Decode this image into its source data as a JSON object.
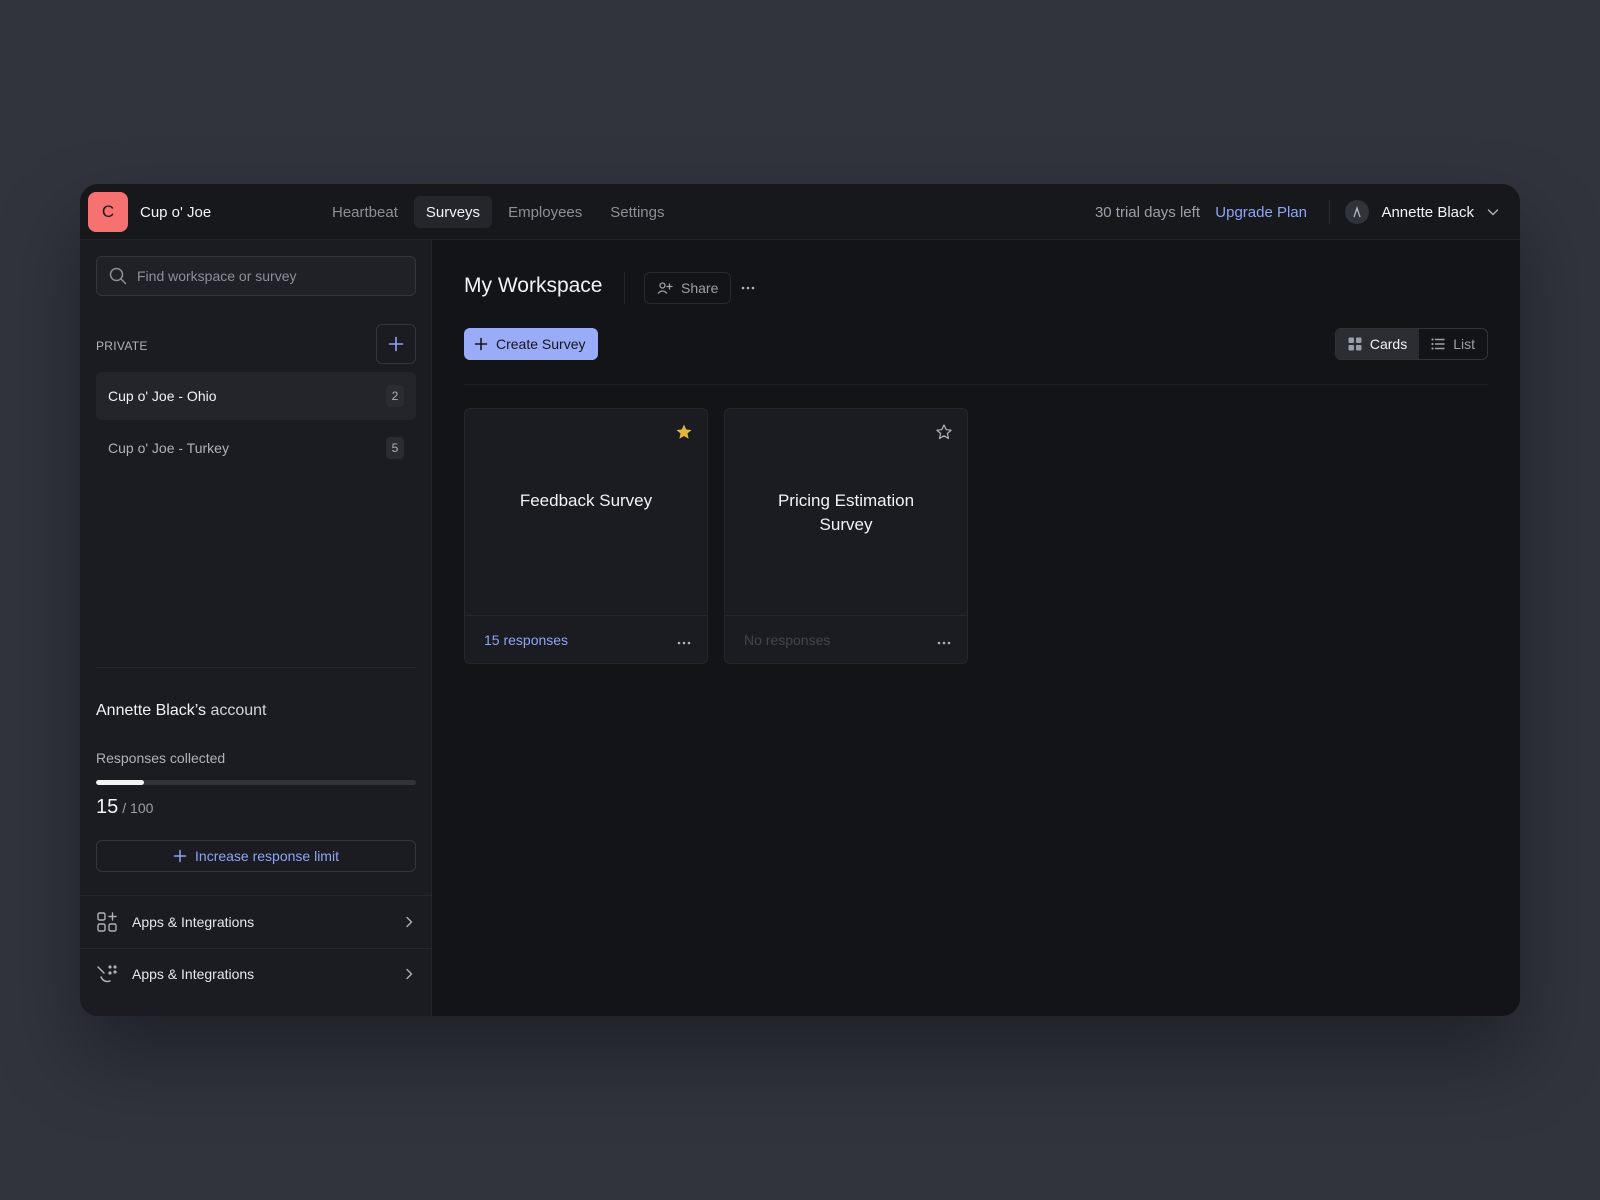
{
  "app": {
    "logo_letter": "C",
    "brand": "Cup o' Joe"
  },
  "nav": {
    "items": [
      {
        "label": "Heartbeat",
        "active": false
      },
      {
        "label": "Surveys",
        "active": true
      },
      {
        "label": "Employees",
        "active": false
      },
      {
        "label": "Settings",
        "active": false
      }
    ]
  },
  "header": {
    "trial_text": "30 trial days left",
    "upgrade_label": "Upgrade Plan",
    "user_name": "Annette Black"
  },
  "sidebar": {
    "search_placeholder": "Find workspace or survey",
    "section_label": "PRIVATE",
    "workspaces": [
      {
        "name": "Cup o' Joe - Ohio",
        "count": "2",
        "active": true
      },
      {
        "name": "Cup o' Joe - Turkey",
        "count": "5",
        "active": false
      }
    ],
    "account": {
      "owner": "Annette Black’s",
      "suffix": "account",
      "responses_label": "Responses collected",
      "collected": "15",
      "limit": "/ 100",
      "progress_fraction": 0.15,
      "increase_label": "Increase response limit"
    },
    "links": [
      {
        "label": "Apps & Integrations",
        "icon": "apps-grid-icon"
      },
      {
        "label": "Apps & Integrations",
        "icon": "integrations-icon"
      }
    ]
  },
  "main": {
    "title": "My Workspace",
    "share_label": "Share",
    "create_label": "Create Survey",
    "views": [
      {
        "label": "Cards",
        "active": true
      },
      {
        "label": "List",
        "active": false
      }
    ],
    "surveys": [
      {
        "title": "Feedback Survey",
        "responses": "15 responses",
        "starred": true
      },
      {
        "title": "Pricing Estimation Survey",
        "responses": "No responses",
        "starred": false
      }
    ]
  },
  "colors": {
    "accent": "#8fa4f5",
    "logo_bg": "#f87171",
    "star_filled": "#e2b93b"
  }
}
